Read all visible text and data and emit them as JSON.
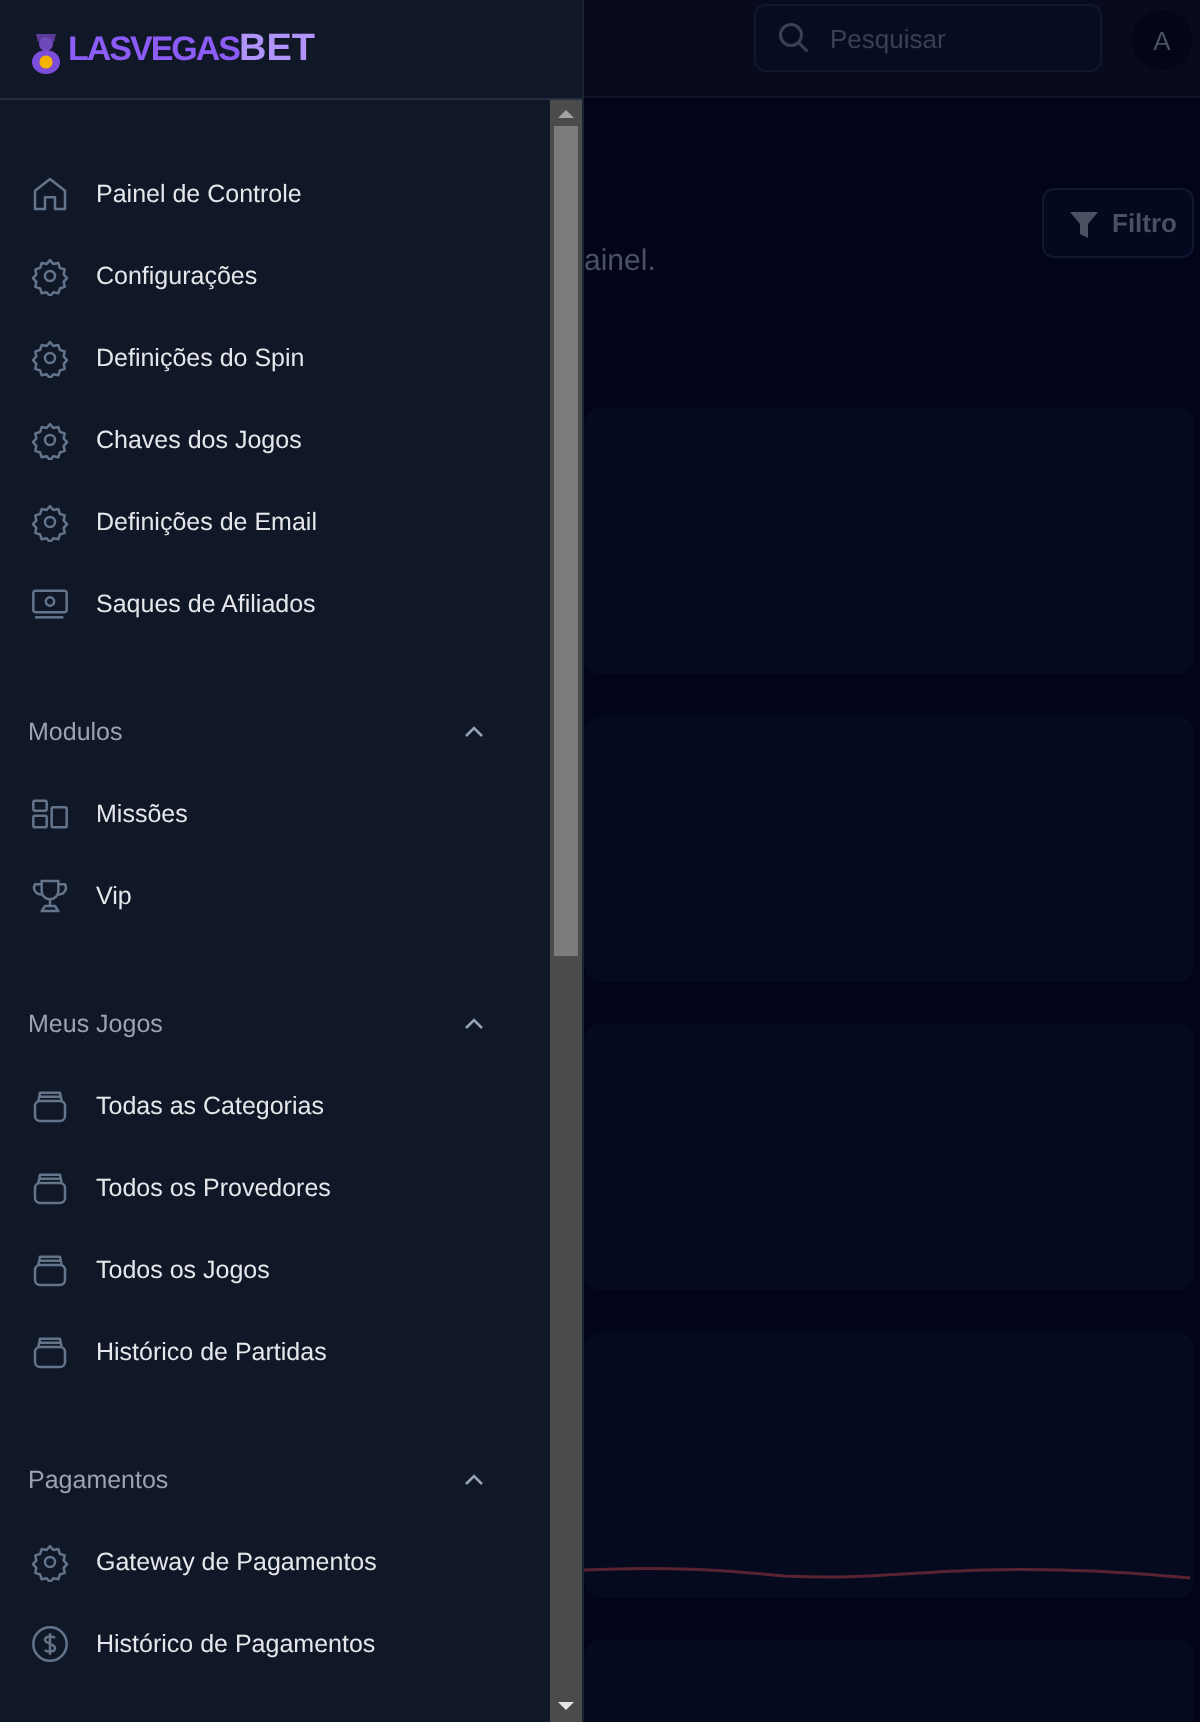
{
  "logo": {
    "text": "LASVEGAS**BET**"
  },
  "search": {
    "placeholder": "Pesquisar"
  },
  "avatar": {
    "initial": "A"
  },
  "sidebar": {
    "items": [
      {
        "label": "Painel de Controle",
        "kind": "home"
      },
      {
        "label": "Configurações",
        "kind": "gear"
      },
      {
        "label": "Definições do Spin",
        "kind": "gear"
      },
      {
        "label": "Chaves dos Jogos",
        "kind": "gear"
      },
      {
        "label": "Definições de Email",
        "kind": "gear"
      },
      {
        "label": "Saques de Afiliados",
        "kind": "money"
      }
    ],
    "sections": [
      {
        "title": "Modulos",
        "expanded": true,
        "items": [
          {
            "label": "Missões",
            "kind": "layout"
          },
          {
            "label": "Vip",
            "kind": "trophy"
          }
        ]
      },
      {
        "title": "Meus Jogos",
        "expanded": true,
        "items": [
          {
            "label": "Todas as Categorias",
            "kind": "tray"
          },
          {
            "label": "Todos os Provedores",
            "kind": "tray"
          },
          {
            "label": "Todos os Jogos",
            "kind": "tray"
          },
          {
            "label": "Histórico de Partidas",
            "kind": "tray"
          }
        ]
      },
      {
        "title": "Pagamentos",
        "expanded": true,
        "items": [
          {
            "label": "Gateway de Pagamentos",
            "kind": "gear"
          },
          {
            "label": "Histórico de Pagamentos",
            "kind": "dollar"
          }
        ]
      }
    ]
  },
  "main": {
    "subtitle": "ainel.",
    "filter_button": "Filtro",
    "cards": [
      {
        "kind": "blank"
      },
      {
        "kind": "blank"
      },
      {
        "kind": "blank"
      },
      {
        "kind": "sparkline"
      },
      {
        "kind": "blank"
      }
    ]
  }
}
